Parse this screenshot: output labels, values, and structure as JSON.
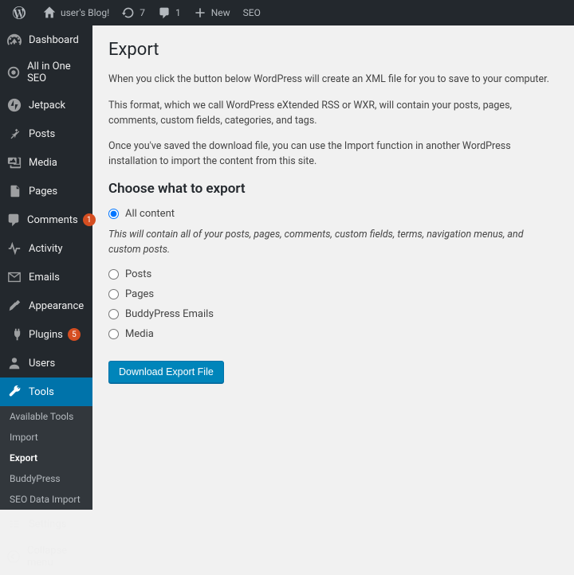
{
  "toolbar": {
    "site_name": "user's Blog!",
    "updates_count": "7",
    "comments_count": "1",
    "new_label": "New",
    "seo_label": "SEO"
  },
  "sidebar": {
    "items": [
      {
        "label": "Dashboard"
      },
      {
        "label": "All in One SEO"
      },
      {
        "label": "Jetpack"
      },
      {
        "label": "Posts"
      },
      {
        "label": "Media"
      },
      {
        "label": "Pages"
      },
      {
        "label": "Comments",
        "badge": "1"
      },
      {
        "label": "Activity"
      },
      {
        "label": "Emails"
      },
      {
        "label": "Appearance"
      },
      {
        "label": "Plugins",
        "badge": "5"
      },
      {
        "label": "Users"
      },
      {
        "label": "Tools"
      },
      {
        "label": "Settings"
      }
    ],
    "submenu": [
      {
        "label": "Available Tools"
      },
      {
        "label": "Import"
      },
      {
        "label": "Export"
      },
      {
        "label": "BuddyPress"
      },
      {
        "label": "SEO Data Import"
      }
    ],
    "collapse_label": "Collapse menu"
  },
  "main": {
    "title": "Export",
    "p1": "When you click the button below WordPress will create an XML file for you to save to your computer.",
    "p2": "This format, which we call WordPress eXtended RSS or WXR, will contain your posts, pages, comments, custom fields, categories, and tags.",
    "p3": "Once you've saved the download file, you can use the Import function in another WordPress installation to import the content from this site.",
    "choose_heading": "Choose what to export",
    "options": {
      "all": "All content",
      "all_desc": "This will contain all of your posts, pages, comments, custom fields, terms, navigation menus, and custom posts.",
      "posts": "Posts",
      "pages": "Pages",
      "bp_emails": "BuddyPress Emails",
      "media": "Media"
    },
    "download_button": "Download Export File"
  }
}
